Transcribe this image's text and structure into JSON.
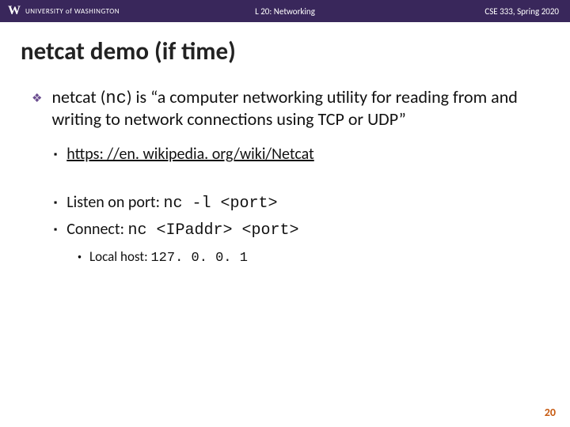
{
  "header": {
    "org_mark": "W",
    "org_name": "UNIVERSITY of WASHINGTON",
    "center": "L 20:  Networking",
    "right": "CSE 333, Spring 2020"
  },
  "title": "netcat demo (if time)",
  "b1_a": "netcat (",
  "b1_code": "nc",
  "b1_b": ") is “a computer networking utility for reading from and writing to network connections using TCP or UDP”",
  "link": "https: //en. wikipedia. org/wiki/Netcat",
  "listen_label": "Listen on port:  ",
  "listen_cmd": "nc -l <port>",
  "connect_label": "Connect:  ",
  "connect_cmd": "nc <IPaddr> <port>",
  "localhost_label": "Local host:  ",
  "localhost_val": "127. 0. 0. 1",
  "page": "20"
}
